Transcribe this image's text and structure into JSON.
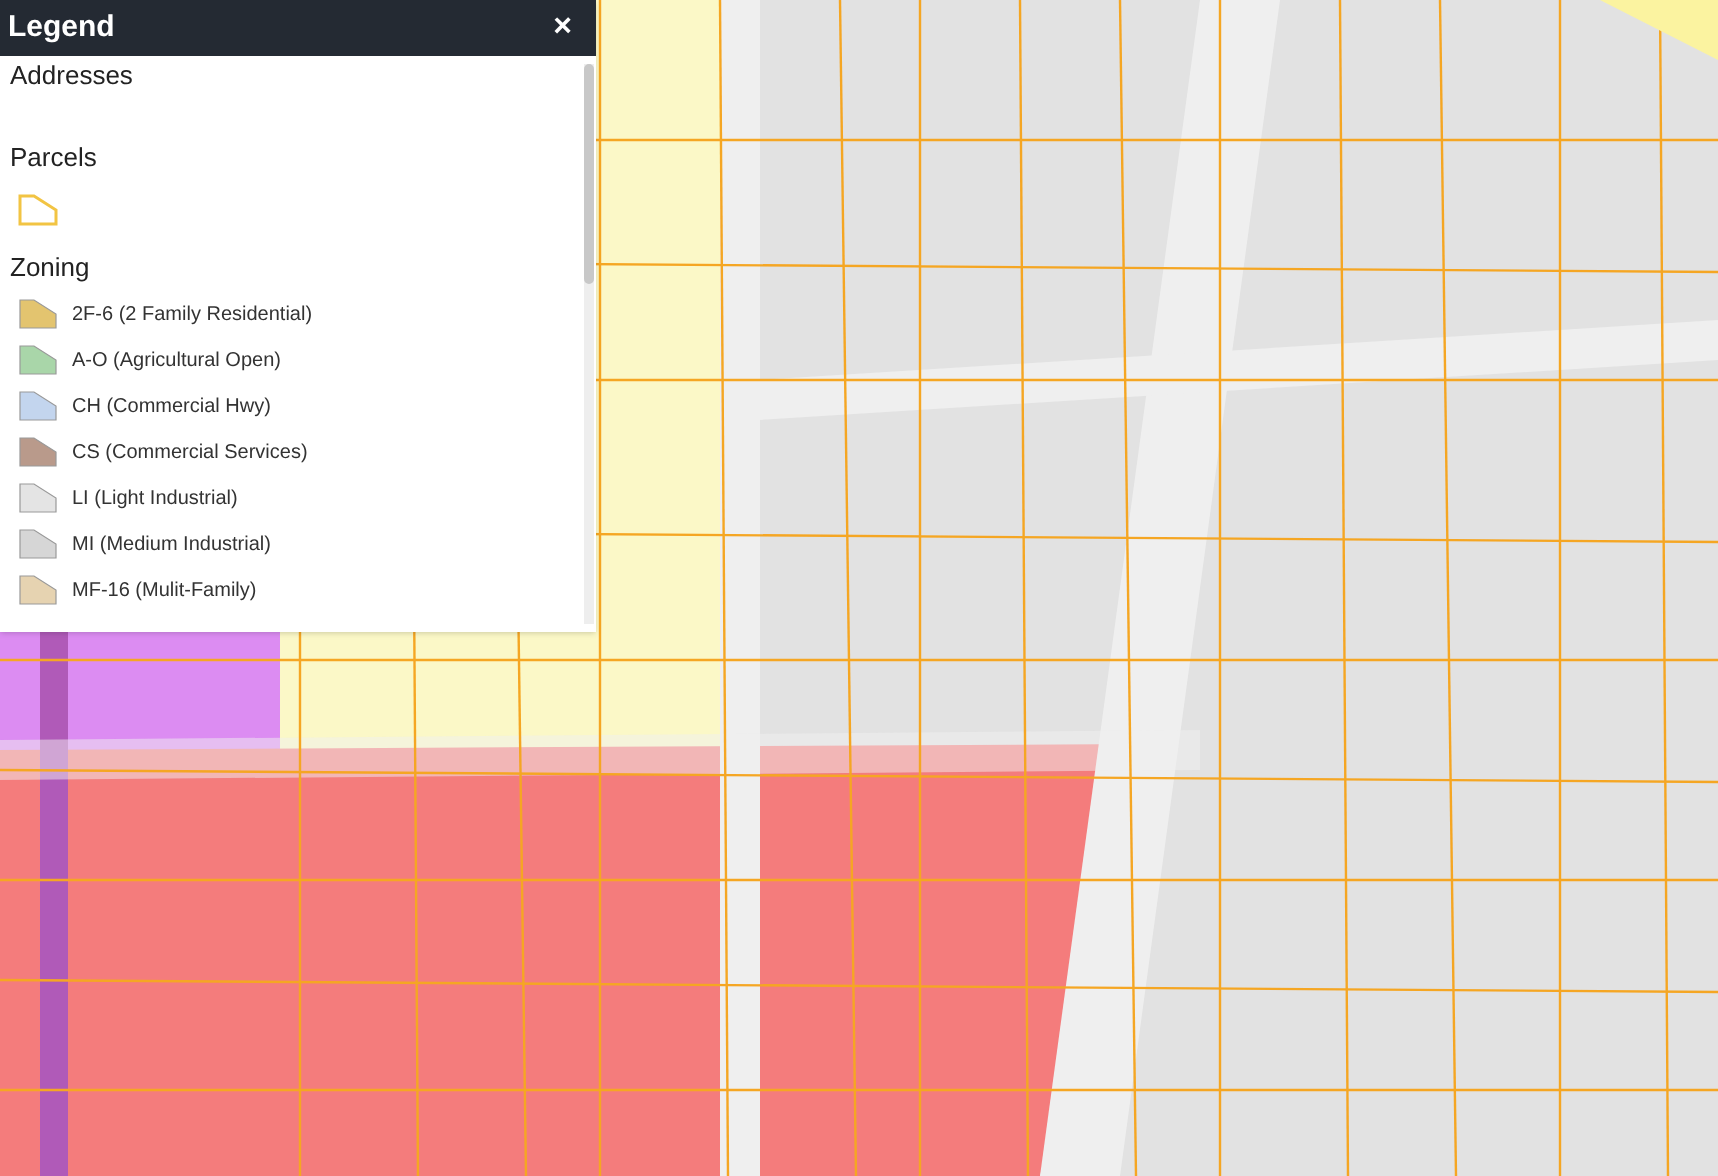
{
  "legend": {
    "title": "Legend",
    "close": "×",
    "sections": [
      {
        "kind": "empty",
        "title": "Addresses"
      },
      {
        "kind": "outline",
        "title": "Parcels",
        "items": [
          {
            "color": "#f2c443"
          }
        ]
      },
      {
        "kind": "fill",
        "title": "Zoning",
        "items": [
          {
            "label": "2F-6 (2 Family Residential)",
            "color": "#e3c46f"
          },
          {
            "label": "A-O (Agricultural Open)",
            "color": "#a9d6a9"
          },
          {
            "label": "CH (Commercial Hwy)",
            "color": "#c3d5ee"
          },
          {
            "label": "CS (Commercial Services)",
            "color": "#b99a8b"
          },
          {
            "label": "LI (Light Industrial)",
            "color": "#e4e4e4"
          },
          {
            "label": "MI (Medium Industrial)",
            "color": "#d6d6d6"
          },
          {
            "label": "MF-16 (Mulit-Family)",
            "color": "#e6d3b1"
          }
        ]
      }
    ]
  }
}
